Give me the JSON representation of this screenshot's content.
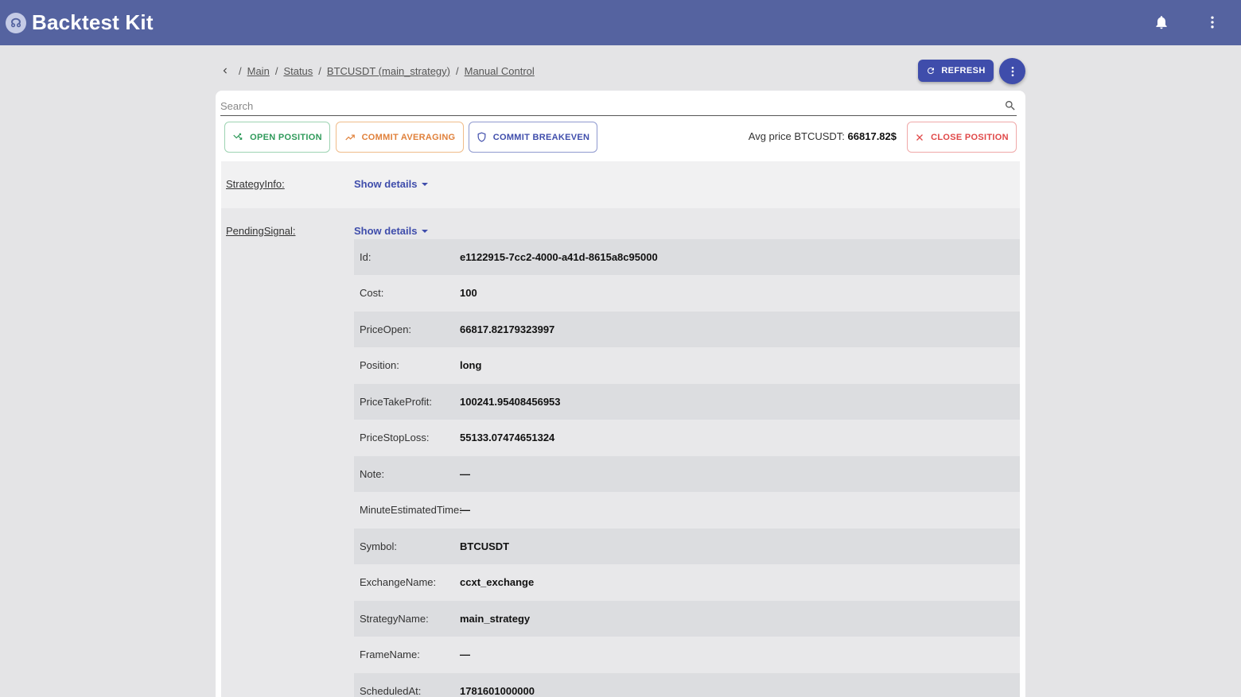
{
  "app": {
    "title": "Backtest Kit",
    "logo_glyph": "☊"
  },
  "header": {
    "bell_icon": "bell-icon",
    "more_icon": "kebab-icon"
  },
  "breadcrumb": {
    "items": [
      "Main",
      "Status",
      "BTCUSDT (main_strategy)",
      "Manual Control"
    ],
    "separator": "/"
  },
  "toolbar": {
    "refresh_label": "REFRESH"
  },
  "search": {
    "placeholder": "Search",
    "value": ""
  },
  "actions": {
    "open_label": "OPEN POSITION",
    "avg_label": "COMMIT AVERAGING",
    "breakeven_label": "COMMIT BREAKEVEN",
    "close_label": "CLOSE POSITION",
    "avg_price_label": "Avg price BTCUSDT:",
    "avg_price_value": "66817.82$"
  },
  "sections": {
    "strategy_info": {
      "label": "StrategyInfo:",
      "toggle": "Show details"
    },
    "pending_signal": {
      "label": "PendingSignal:",
      "toggle": "Show details",
      "rows": [
        {
          "key": "Id:",
          "value": "e1122915-7cc2-4000-a41d-8615a8c95000"
        },
        {
          "key": "Cost:",
          "value": "100"
        },
        {
          "key": "PriceOpen:",
          "value": "66817.82179323997"
        },
        {
          "key": "Position:",
          "value": "long"
        },
        {
          "key": "PriceTakeProfit:",
          "value": "100241.95408456953"
        },
        {
          "key": "PriceStopLoss:",
          "value": "55133.07474651324"
        },
        {
          "key": "Note:",
          "value": "—"
        },
        {
          "key": "MinuteEstimatedTime:",
          "value": "—"
        },
        {
          "key": "Symbol:",
          "value": "BTCUSDT"
        },
        {
          "key": "ExchangeName:",
          "value": "ccxt_exchange"
        },
        {
          "key": "StrategyName:",
          "value": "main_strategy"
        },
        {
          "key": "FrameName:",
          "value": "—"
        },
        {
          "key": "ScheduledAt:",
          "value": "1781601000000"
        }
      ]
    }
  },
  "colors": {
    "appbar": "#5563a0",
    "primary": "#3f4dab",
    "success": "#2f9a5a",
    "warning": "#e0803a",
    "danger": "#e04848"
  }
}
